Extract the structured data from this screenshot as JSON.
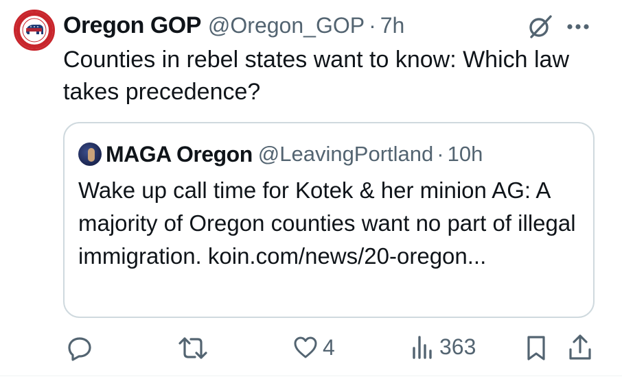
{
  "tweet": {
    "avatar_icon": "oregon-republican-party-logo",
    "author_name": "Oregon GOP",
    "author_handle": "@Oregon_GOP",
    "separator": "·",
    "time": "7h",
    "text": "Counties in rebel states want to know: Which law takes precedence?"
  },
  "quote": {
    "author_name": "MAGA Oregon",
    "author_handle": "@LeavingPortland",
    "separator": "·",
    "time": "10h",
    "text": "Wake up call time for Kotek & her minion AG: A majority of Oregon counties want no part of illegal immigration. koin.com/news/20-oregon..."
  },
  "actions": {
    "reply_icon": "reply-icon",
    "retweet_icon": "retweet-icon",
    "like_icon": "heart-icon",
    "like_count": "4",
    "views_icon": "views-icon",
    "views_count": "363",
    "bookmark_icon": "bookmark-icon",
    "share_icon": "share-icon"
  },
  "colors": {
    "text": "#0f1419",
    "secondary": "#536471",
    "border": "#cfd9de",
    "logo_red": "#c8252c",
    "logo_blue": "#1f3b75"
  }
}
